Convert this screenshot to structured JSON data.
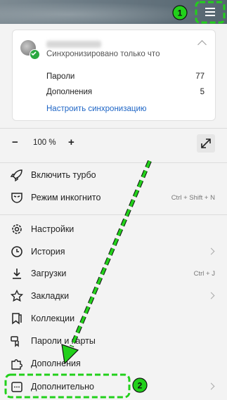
{
  "sync": {
    "status": "Синхронизировано только что",
    "rows": [
      {
        "label": "Пароли",
        "count": "77"
      },
      {
        "label": "Дополнения",
        "count": "5"
      }
    ],
    "configure_link": "Настроить синхронизацию"
  },
  "zoom": {
    "minus": "−",
    "value": "100 %",
    "plus": "+"
  },
  "menu": {
    "turbo": "Включить турбо",
    "incognito": "Режим инкогнито",
    "incognito_shortcut": "Ctrl + Shift + N",
    "settings": "Настройки",
    "history": "История",
    "downloads": "Загрузки",
    "downloads_shortcut": "Ctrl + J",
    "bookmarks": "Закладки",
    "collections": "Коллекции",
    "passwords": "Пароли и карты",
    "extensions": "Дополнения",
    "more": "Дополнительно"
  },
  "annotations": {
    "step1": "1",
    "step2": "2",
    "color": "#22d01b"
  }
}
